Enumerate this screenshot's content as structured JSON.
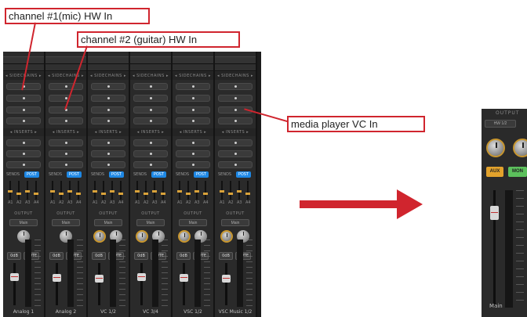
{
  "callouts": {
    "mic": "channel #1(mic) HW In",
    "guitar": "channel #2 (guitar) HW In",
    "media": "media player VC In"
  },
  "mixer": {
    "sidechains_label": "◂ SIDECHAINS ▸",
    "inserts_label": "◂ INSERTS ▸",
    "sends_label": "SENDS",
    "post_badge": "POST",
    "aux_labels": [
      "A1",
      "A2",
      "A3",
      "A4"
    ],
    "output_label": "OUTPUT",
    "output_value": "Main",
    "zero_db_label": "0dB",
    "mute_label": "MUTE",
    "channels": [
      {
        "name": "Analog 1"
      },
      {
        "name": "Analog 2"
      },
      {
        "name": "VC 1/2"
      },
      {
        "name": "VC 3/4"
      },
      {
        "name": "VSC 1/2"
      },
      {
        "name": "VSC Music 1/2"
      }
    ]
  },
  "detail_strip": {
    "output_label": "OUTPUT",
    "output_value": "HW 1/2",
    "aux_button": "AUX",
    "mon_button": "MON",
    "name": "Main"
  },
  "colors": {
    "callout_border": "#d0252e",
    "arrow": "#d0252e",
    "post_badge": "#1e88e5",
    "aux_button": "#e2a22c",
    "mon_button": "#5cc05c",
    "knob_ring": "#c8962e"
  }
}
